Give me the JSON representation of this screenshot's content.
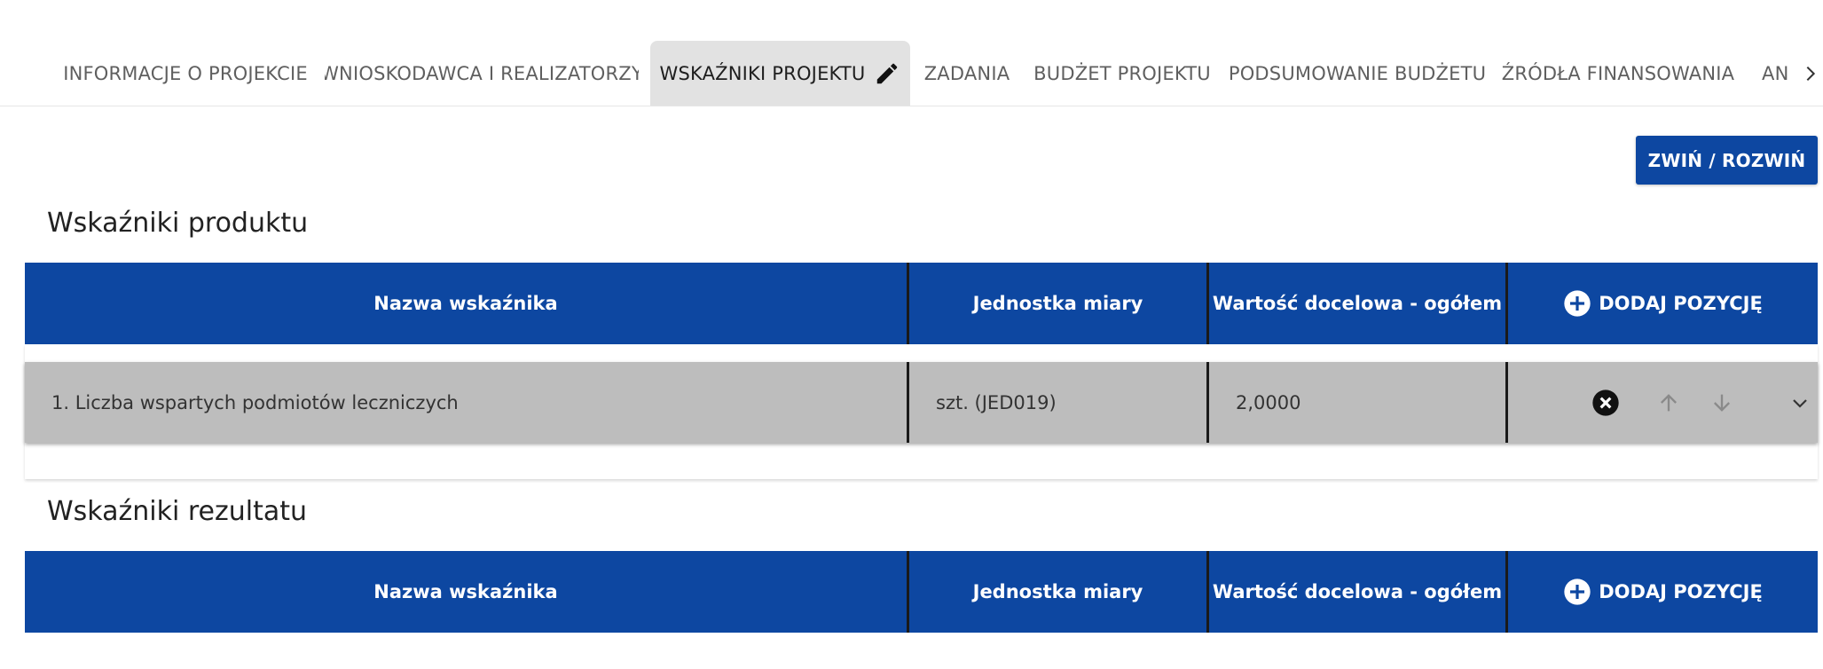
{
  "tabs": {
    "items": [
      {
        "label": "INFORMACJE O PROJEKCIE"
      },
      {
        "label": "WNIOSKODAWCA I REALIZATORZY"
      },
      {
        "label": "WSKAŹNIKI PROJEKTU"
      },
      {
        "label": "ZADANIA"
      },
      {
        "label": "BUDŻET PROJEKTU"
      },
      {
        "label": "PODSUMOWANIE BUDŻETU"
      },
      {
        "label": "ŹRÓDŁA FINANSOWANIA"
      },
      {
        "label": "AN"
      }
    ],
    "active_index": 2,
    "active_icon": "pencil-icon",
    "scroll_icon": "chevron-right-icon"
  },
  "toolbar": {
    "toggle_label": "ZWIŃ / ROZWIŃ"
  },
  "product_indicators": {
    "title": "Wskaźniki produktu",
    "columns": [
      "Nazwa wskaźnika",
      "Jednostka miary",
      "Wartość docelowa - ogółem"
    ],
    "add_label": "DODAJ POZYCJĘ",
    "rows": [
      {
        "name": "1. Liczba wspartych podmiotów leczniczych",
        "unit": "szt. (JED019)",
        "value": "2,0000"
      }
    ]
  },
  "result_indicators": {
    "title": "Wskaźniki rezultatu",
    "columns": [
      "Nazwa wskaźnika",
      "Jednostka miary",
      "Wartość docelowa - ogółem"
    ],
    "add_label": "DODAJ POZYCJĘ",
    "rows": []
  },
  "colors": {
    "accent": "#0d47a1",
    "active_tab_bg": "#e2e2e2",
    "row_bg": "#bdbdbd"
  }
}
